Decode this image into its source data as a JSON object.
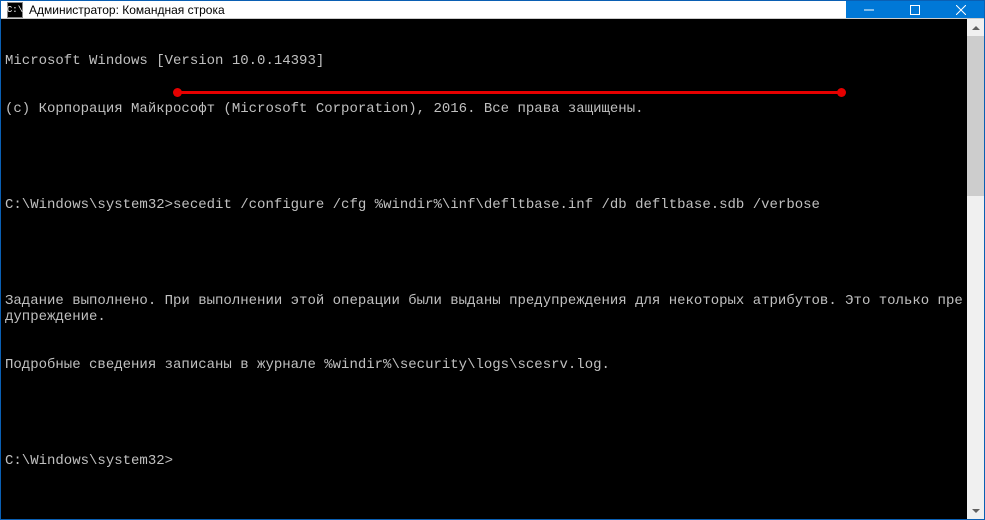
{
  "window": {
    "title": "Администратор: Командная строка",
    "icon_glyph": "C:\\"
  },
  "terminal": {
    "line1": "Microsoft Windows [Version 10.0.14393]",
    "line2": "(c) Корпорация Майкрософт (Microsoft Corporation), 2016. Все права защищены.",
    "prompt1": "C:\\Windows\\system32>",
    "command1": "secedit /configure /cfg %windir%\\inf\\defltbase.inf /db defltbase.sdb /verbose",
    "output1": "Задание выполнено. При выполнении этой операции были выданы предупреждения для некоторых атрибутов. Это только предупреждение.",
    "output2": "Подробные сведения записаны в журнале %windir%\\security\\logs\\scesrv.log.",
    "prompt2": "C:\\Windows\\system32>"
  },
  "colors": {
    "titlebar_accent": "#0078d7",
    "terminal_bg": "#000000",
    "terminal_fg": "#c0c0c0",
    "annotation": "#e60000"
  }
}
